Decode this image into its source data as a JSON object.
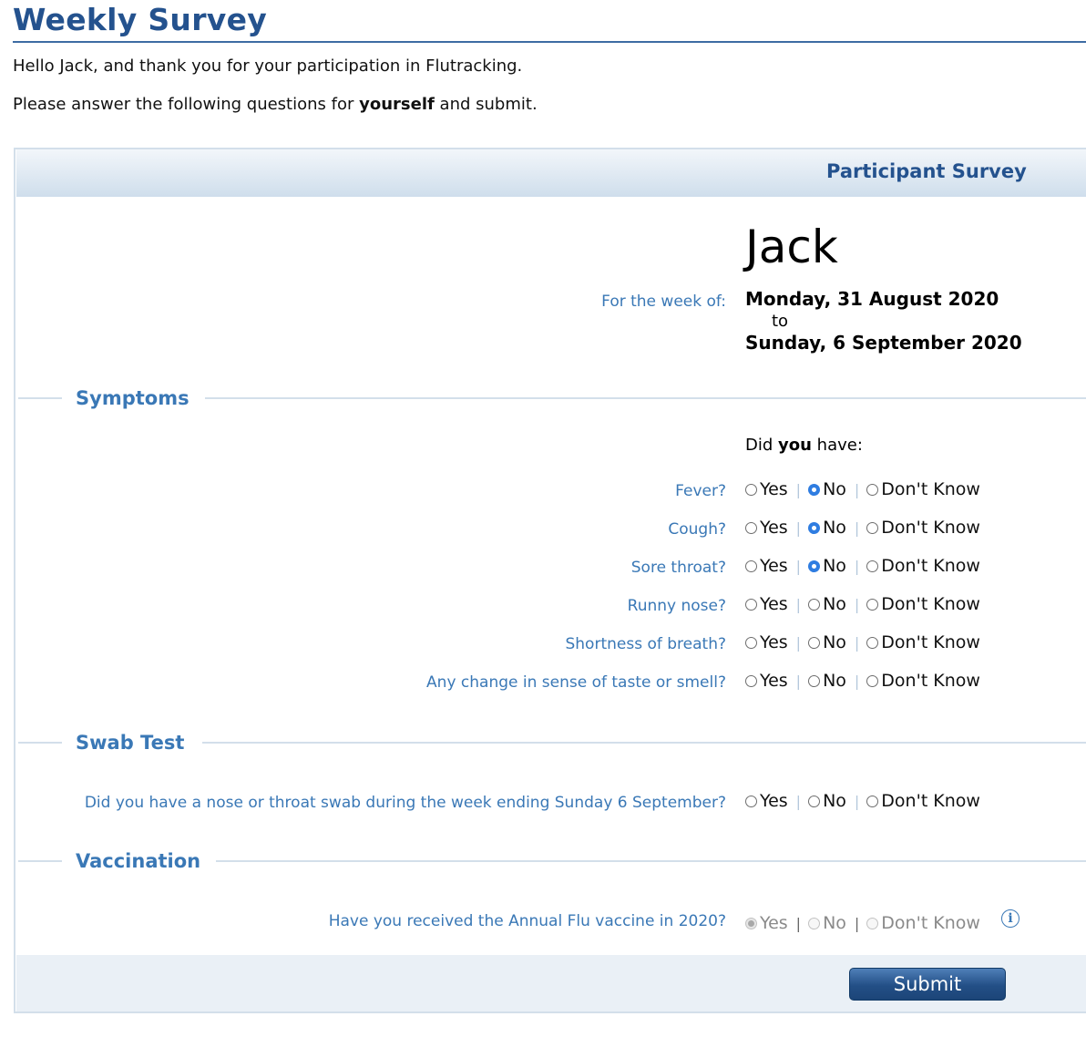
{
  "page": {
    "title": "Weekly Survey",
    "intro_line1": "Hello Jack, and thank you for your participation in Flutracking.",
    "intro_line2_prefix": "Please answer the following questions for ",
    "intro_line2_bold": "yourself",
    "intro_line2_suffix": " and submit."
  },
  "panel": {
    "header_title": "Participant Survey",
    "participant_name": "Jack",
    "week_label": "For the week of:",
    "week_start": "Monday, 31 August 2020",
    "week_to": "to",
    "week_end": "Sunday, 6 September 2020"
  },
  "options": {
    "yes": "Yes",
    "no": "No",
    "dont_know": "Don't Know",
    "separator": "|"
  },
  "symptoms": {
    "section_title": "Symptoms",
    "prompt_prefix": "Did ",
    "prompt_bold": "you",
    "prompt_suffix": " have:",
    "questions": [
      {
        "label": "Fever?",
        "selected": "no"
      },
      {
        "label": "Cough?",
        "selected": "no"
      },
      {
        "label": "Sore throat?",
        "selected": "no"
      },
      {
        "label": "Runny nose?",
        "selected": null
      },
      {
        "label": "Shortness of breath?",
        "selected": null
      },
      {
        "label": "Any change in sense of taste or smell?",
        "selected": null
      }
    ]
  },
  "swab": {
    "section_title": "Swab Test",
    "question": "Did you have a nose or throat swab during the week ending Sunday 6 September?",
    "selected": null
  },
  "vaccination": {
    "section_title": "Vaccination",
    "question": "Have you received the Annual Flu vaccine in 2020?",
    "selected": "yes",
    "disabled": true,
    "info_icon": "info-icon"
  },
  "footer": {
    "submit_label": "Submit"
  },
  "colors": {
    "title": "#24528e",
    "label": "#3a78b6",
    "radio_checked": "#2f7de1",
    "panel_border": "#d3dfea"
  }
}
